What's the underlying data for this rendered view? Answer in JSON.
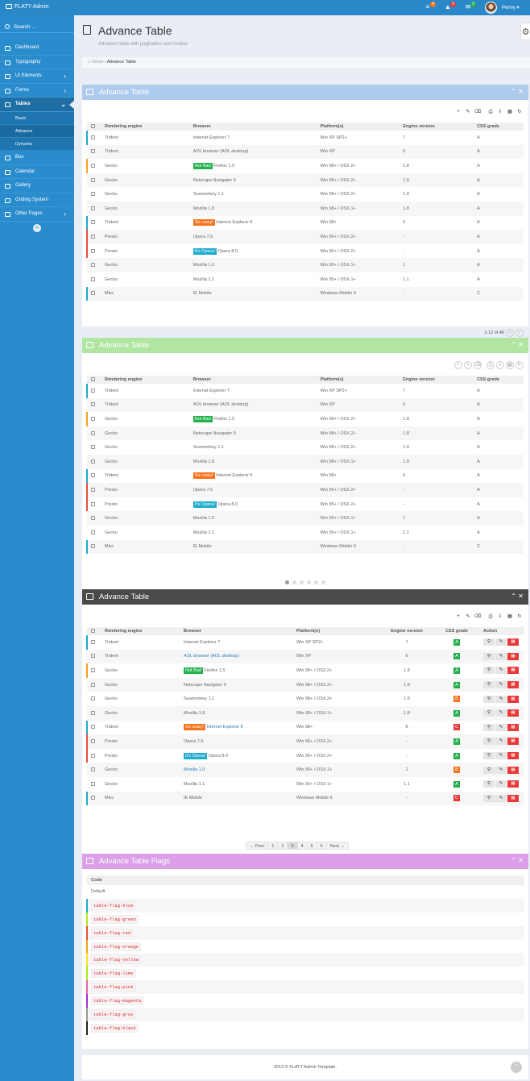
{
  "app": {
    "title": "FLATY Admin"
  },
  "topbar": {
    "badges": [
      {
        "icon": "tasks-icon",
        "count": "4",
        "color": "#f7731c"
      },
      {
        "icon": "bell-icon",
        "count": "5",
        "color": "#e83a3a"
      },
      {
        "icon": "envelope-icon",
        "count": "3",
        "color": "#22b14c"
      }
    ],
    "user": "Penny"
  },
  "sidebar": {
    "search_placeholder": "Search ...",
    "items": [
      {
        "label": "Dashboard",
        "icon": "dashboard-icon"
      },
      {
        "label": "Typography",
        "icon": "text-icon"
      },
      {
        "label": "UI Elements",
        "icon": "ui-icon",
        "chevron": "›"
      },
      {
        "label": "Forms",
        "icon": "edit-icon",
        "chevron": "›"
      },
      {
        "label": "Tables",
        "icon": "table-icon",
        "chevron": "⌄",
        "active": true
      }
    ],
    "sub_items": [
      "Basic",
      "Advance",
      "Dynamic"
    ],
    "items_after": [
      {
        "label": "Box",
        "icon": "box-icon"
      },
      {
        "label": "Calendar",
        "icon": "calendar-icon"
      },
      {
        "label": "Gallery",
        "icon": "picture-icon"
      },
      {
        "label": "Griding System",
        "icon": "grid-icon"
      },
      {
        "label": "Other Pages",
        "icon": "file-icon",
        "chevron": "›"
      }
    ],
    "collapse": "«"
  },
  "page": {
    "title": "Advance Table",
    "subtitle": "Advance table with pagination and toolbar",
    "breadcrumb": {
      "home": "Home",
      "sep": "/",
      "current": "Advance Table"
    }
  },
  "tables": {
    "columns": [
      "Rendering engine",
      "Browser",
      "Platform(s)",
      "Engine version",
      "CSS grade"
    ],
    "rows": [
      {
        "flag": "#1eaccd",
        "engine": "Trident",
        "label": "",
        "label_class": "",
        "browser": "Internet Explorer 7",
        "platform": "Win XP SP2+",
        "version": "7",
        "grade": "A",
        "link": false
      },
      {
        "flag": "",
        "engine": "Trident",
        "label": "",
        "label_class": "",
        "browser": "AOL browser (AOL desktop)",
        "platform": "Win XP",
        "version": "6",
        "grade": "A",
        "link": true
      },
      {
        "flag": "#f7a31c",
        "engine": "Gecko",
        "label": "Not Bad",
        "label_class": "l-green",
        "browser": "Firefox 1.5",
        "platform": "Win 98+ / OSX.2+",
        "version": "1.8",
        "grade": "A",
        "link": false
      },
      {
        "flag": "",
        "engine": "Gecko",
        "label": "",
        "label_class": "",
        "browser": "Netscape Navigator 9",
        "platform": "Win 98+ / OSX.2+",
        "version": "1.8",
        "grade": "A",
        "link": false
      },
      {
        "flag": "",
        "engine": "Gecko",
        "label": "",
        "label_class": "",
        "browser": "Seamonkey 1.1",
        "platform": "Win 98+ / OSX.2+",
        "version": "1.8",
        "grade": "A",
        "link": false
      },
      {
        "flag": "",
        "engine": "Gecko",
        "label": "",
        "label_class": "",
        "browser": "Mozilla 1.8",
        "platform": "Win 98+ / OSX.1+",
        "version": "1.8",
        "grade": "A",
        "link": false
      },
      {
        "flag": "#1eaccd",
        "engine": "Trident",
        "label": "So crazy!",
        "label_class": "l-orange",
        "browser": "Internet Explorer 6",
        "platform": "Win 98+",
        "version": "6",
        "grade": "A",
        "link": true
      },
      {
        "flag": "#e8503a",
        "engine": "Presto",
        "label": "",
        "label_class": "",
        "browser": "Opera 7.5",
        "platform": "Win 95+ / OSX.2+",
        "version": "-",
        "grade": "A",
        "link": false
      },
      {
        "flag": "#e8503a",
        "engine": "Presto",
        "label": "It's Opera!",
        "label_class": "l-cyan",
        "browser": "Opera 8.0",
        "platform": "Win 95+ / OSX.2+",
        "version": "-",
        "grade": "A",
        "link": false
      },
      {
        "flag": "",
        "engine": "Gecko",
        "label": "",
        "label_class": "",
        "browser": "Mozilla 1.0",
        "platform": "Win 95+ / OSX.1+",
        "version": "1",
        "grade": "A",
        "link": true
      },
      {
        "flag": "",
        "engine": "Gecko",
        "label": "",
        "label_class": "",
        "browser": "Mozilla 1.1",
        "platform": "Win 95+ / OSX.1+",
        "version": "1.1",
        "grade": "A",
        "link": false
      },
      {
        "flag": "#1eaccd",
        "engine": "Misc",
        "label": "",
        "label_class": "",
        "browser": "IE Mobile",
        "platform": "Windows Mobile 6",
        "version": "-",
        "grade": "C",
        "link": false
      }
    ]
  },
  "table3_grades": [
    "A",
    "A",
    "A",
    "A",
    "B",
    "A",
    "C",
    "A",
    "A",
    "B",
    "A",
    "C"
  ],
  "grade_colors": {
    "A": "#22b14c",
    "B": "#f7731c",
    "C": "#e83a3a"
  },
  "box1": {
    "title": "Advance Table",
    "color": "#aecbee",
    "pager_text": "1-12 of 46"
  },
  "box2": {
    "title": "Advance Table",
    "color": "#b0e6a2"
  },
  "box3": {
    "title": "Advance Table",
    "color": "#4a4a4a",
    "action_header": "Action",
    "pagination": [
      "← Prev",
      "1",
      "2",
      "3",
      "4",
      "5",
      "6",
      "Next →"
    ],
    "current_page": "3"
  },
  "box4": {
    "title": "Advance Table Flags",
    "color": "#dba0e8",
    "code_header": "Code",
    "rows": [
      {
        "text": "Default",
        "flag": ""
      },
      {
        "text": "table-flag-blue",
        "flag": "#1eaccd"
      },
      {
        "text": "table-flag-green",
        "flag": "#b5e61d"
      },
      {
        "text": "table-flag-red",
        "flag": "#e8503a"
      },
      {
        "text": "table-flag-orange",
        "flag": "#f7a31c"
      },
      {
        "text": "table-flag-yellow",
        "flag": "#f6e31c"
      },
      {
        "text": "table-flag-lime",
        "flag": "#a9e61d"
      },
      {
        "text": "table-flag-pink",
        "flag": "#f25fa4"
      },
      {
        "text": "table-flag-magenta",
        "flag": "#a72fd6"
      },
      {
        "text": "table-flag-gray",
        "flag": "#999999"
      },
      {
        "text": "table-flag-black",
        "flag": "#222222"
      }
    ]
  },
  "footer": {
    "text": "2013 © FLATY Admin Template."
  }
}
